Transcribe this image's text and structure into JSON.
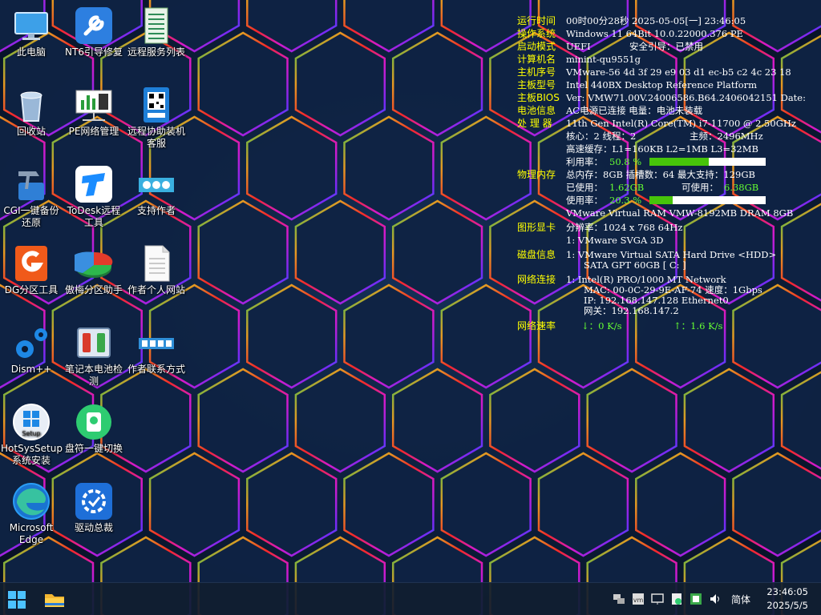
{
  "desktop_icons": [
    {
      "label": "此电脑"
    },
    {
      "label": "NT6引导修复"
    },
    {
      "label": "远程服务列表"
    },
    {
      "label": "回收站"
    },
    {
      "label": "PE网络管理"
    },
    {
      "label": "远程协助装机客服"
    },
    {
      "label": "CGI一键备份还原"
    },
    {
      "label": "ToDesk远程工具"
    },
    {
      "label": "支持作者"
    },
    {
      "label": "DG分区工具"
    },
    {
      "label": "傲梅分区助手"
    },
    {
      "label": "作者个人网站"
    },
    {
      "label": "Dism++"
    },
    {
      "label": "笔记本电池检测"
    },
    {
      "label": "作者联系方式"
    },
    {
      "label": "HotSysSetup系统安装"
    },
    {
      "label": "盘符一键切换"
    },
    {
      "label": "Microsoft Edge"
    },
    {
      "label": "驱动总裁"
    }
  ],
  "sysinfo": {
    "uptime_key": "运行时间",
    "uptime_val": "00时00分28秒 2025-05-05[一] 23:46:05",
    "os_key": "操作系统",
    "os_val": "Windows 11 64Bit 10.0.22000.376 PE",
    "boot_key": "启动模式",
    "boot_val": "UEFI",
    "secure_boot": "安全引导：已禁用",
    "pc_key": "计算机名",
    "pc_val": "minint-qu9551g",
    "serial_key": "主机序号",
    "serial_val": "VMware-56 4d 3f 29 e9 03 d1 ec-b5 c2 4c 23 18",
    "board_key": "主板型号",
    "board_val": "Intel 440BX Desktop Reference Platform",
    "bios_key": "主板BIOS",
    "bios_val": "Ver: VMW71.00V.24006586.B64.2406042151  Date:",
    "battery_key": "电池信息",
    "battery_val": "AC电源已连接  电量：电池未装载",
    "cpu_key": "处 理 器",
    "cpu_val": "11th Gen Intel(R) Core(TM) i7-11700 @ 2.50GHz",
    "cpu_cores": "核心：2  线程：2",
    "cpu_freq": "主频：2496MHz",
    "cpu_cache": "高速缓存：L1=160KB L2=1MB L3=32MB",
    "cpu_usage_label": "利用率：",
    "cpu_usage_val": "50.8 %",
    "cpu_usage_fraction": 0.508,
    "mem_key": "物理内存",
    "mem_total": "总内存：8GB 插槽数：64 最大支持：129GB",
    "mem_used_label": "已使用：",
    "mem_used_val": "1.62GB",
    "mem_free_label": "可使用：",
    "mem_free_val": "6.38GB",
    "mem_usage_label": "使用率：",
    "mem_usage_val": "20.3 %",
    "mem_usage_fraction": 0.203,
    "mem_module": "VMware Virtual RAM VMW-8192MB DRAM 8GB",
    "gpu_key": "图形显卡",
    "gpu_res": "分辨率：1024 x 768 64Hz",
    "gpu_name": "1: VMware SVGA 3D",
    "disk_key": "磁盘信息",
    "disk_name": "1: VMware Virtual SATA Hard Drive <HDD>",
    "disk_detail": "SATA GPT 60GB [ C: ]",
    "net_key": "网络连接",
    "net_name": "1: Intel(R) PRO/1000 MT Network",
    "net_mac": "MAC: 00-0C-29-9E-AF-74 速度：1Gbps",
    "net_ip": "IP: 192.168.147.128 Ethernet0",
    "net_gw": "网关：192.168.147.2",
    "speed_key": "网络速率",
    "speed_down": "↓：0 K/s",
    "speed_up": "↑：1.6 K/s"
  },
  "taskbar": {
    "ime_label": "简体",
    "clock_time": "23:46:05",
    "clock_date": "2025/5/5"
  },
  "colors": {
    "label_yellow": "#ffff00",
    "value_green": "#66ff33",
    "bar_fill": "#47c40a",
    "taskbar_bg": "#101e30"
  }
}
